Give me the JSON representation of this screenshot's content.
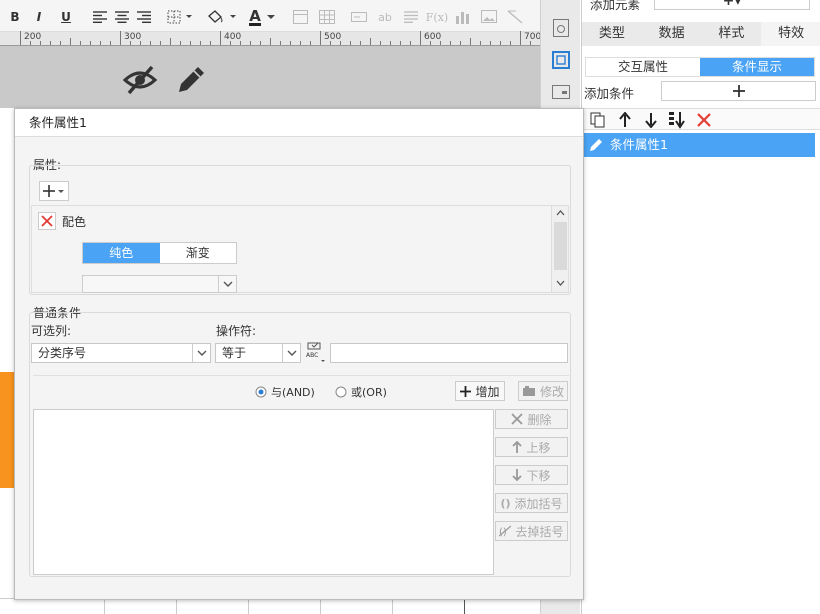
{
  "toolbar": {
    "bold": "B",
    "italic": "I",
    "underline": "U",
    "font_color_glyph": "A",
    "text_glyph": "ab",
    "formula_glyph": "F(x)"
  },
  "ruler": {
    "marks": [
      "200",
      "300",
      "400",
      "500",
      "600",
      "700"
    ]
  },
  "right_panel": {
    "add_element_label": "添加元素",
    "tabs": [
      "类型",
      "数据",
      "样式",
      "特效"
    ],
    "active_tab": "特效",
    "subtabs": [
      "交互属性",
      "条件显示"
    ],
    "active_subtab": "条件显示",
    "add_condition_label": "添加条件",
    "condition_items": [
      "条件属性1"
    ]
  },
  "dialog": {
    "title": "条件属性1",
    "attributes_group": "属性:",
    "attribute_name": "配色",
    "color_modes": [
      "纯色",
      "渐变"
    ],
    "active_color_mode": "纯色",
    "common_group": "普通条件",
    "column_label": "可选列:",
    "column_value": "分类序号",
    "operator_label": "操作符:",
    "operator_value": "等于",
    "formula_icon_text": "ABC",
    "value_input": "",
    "radio_and": "与(AND)",
    "radio_or": "或(OR)",
    "radio_selected": "and",
    "buttons": {
      "add": "增加",
      "modify": "修改",
      "delete": "删除",
      "move_up": "上移",
      "move_down": "下移",
      "add_bracket": "添加括号",
      "remove_bracket": "去掉括号"
    }
  },
  "colors": {
    "accent": "#4aa3f5",
    "selected_row": "#4aa3f5",
    "delete_red": "#e53935"
  }
}
